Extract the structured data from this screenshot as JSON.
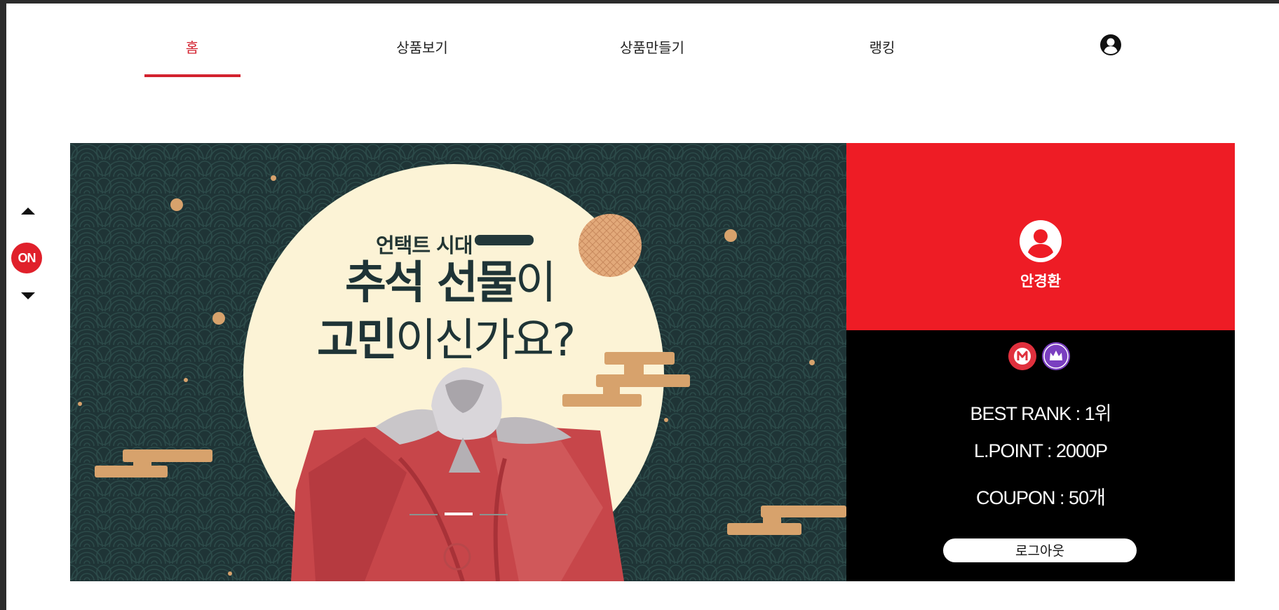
{
  "nav": {
    "items": [
      {
        "label": "홈",
        "active": true
      },
      {
        "label": "상품보기",
        "active": false
      },
      {
        "label": "상품만들기",
        "active": false
      },
      {
        "label": "랭킹",
        "active": false
      }
    ],
    "profile_icon": "user-circle-icon",
    "accent_color": "#d3222f"
  },
  "side_widget": {
    "up_icon": "triangle-up-icon",
    "on_label": "ON",
    "down_icon": "triangle-down-icon"
  },
  "banner": {
    "line1": "언택트 시대",
    "line2_bold": "추석 선물",
    "line2_light": "이",
    "line3_bold": "고민",
    "line3_light": "이신가요?",
    "slides_total": 3,
    "active_slide": 2
  },
  "profile": {
    "name": "안경환",
    "badges": [
      "m-badge-icon",
      "crown-badge-icon"
    ],
    "best_rank": "BEST RANK : 1위",
    "l_point": "L.POINT : 2000P",
    "coupon": "COUPON : 50개",
    "logout_label": "로그아웃",
    "panel_color": "#ee1c25"
  }
}
